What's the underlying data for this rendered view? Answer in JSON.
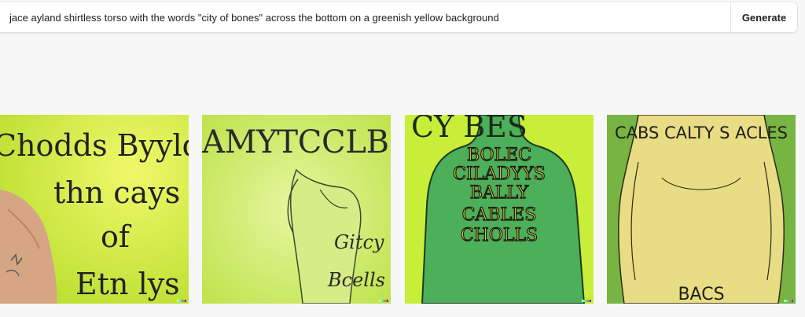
{
  "prompt": {
    "value": "jace ayland shirtless torso with the words \"city of bones\" across the bottom on a greenish yellow background"
  },
  "generate_label": "Generate",
  "images": [
    {
      "lines": [
        "Chodds Byyld",
        "thn cays",
        "of",
        "Etn lys"
      ],
      "bg": "#d6ea3c"
    },
    {
      "top_text": "AMYTCCLB",
      "script_lines": [
        "Gitcy",
        "Bcells"
      ],
      "bg": "#c4e860"
    },
    {
      "top_text": "CY   BES",
      "lines": [
        "BOLEC",
        "CILADYYS",
        "BALLY",
        "CABLES",
        "CHOLLS"
      ],
      "bg": "#c8ee3a",
      "body_color": "#4caf5a"
    },
    {
      "top_text": "CABS CALTY S ACLES",
      "bottom_text": "BACS",
      "bg": "#6fae3e",
      "body_color": "#e8dc84"
    }
  ],
  "badge_colors": [
    "#ffff66",
    "#42ffff",
    "#51da4c",
    "#ff6e3c",
    "#3c46ff"
  ]
}
